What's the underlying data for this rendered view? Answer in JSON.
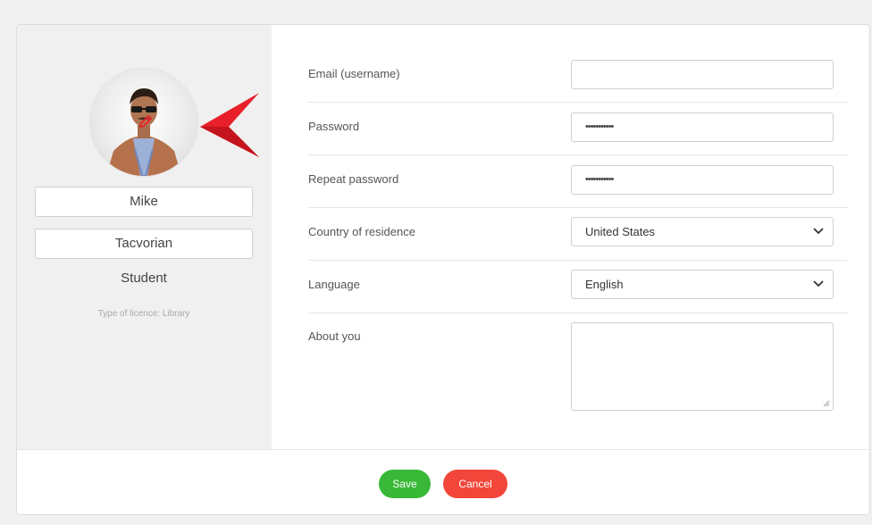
{
  "profile": {
    "first_name": "Mike",
    "last_name": "Tacvorian",
    "role": "Student",
    "licence": "Type of licence: Library",
    "avatar_icon": "user-photo",
    "edit_icon": "pencil-icon"
  },
  "form": {
    "email": {
      "label": "Email (username)",
      "value": ""
    },
    "password": {
      "label": "Password",
      "value": "•••••••••••"
    },
    "repeat_password": {
      "label": "Repeat password",
      "value": "•••••••••••"
    },
    "country": {
      "label": "Country of residence",
      "selected": "United States"
    },
    "language": {
      "label": "Language",
      "selected": "English"
    },
    "about": {
      "label": "About you",
      "value": ""
    }
  },
  "footer": {
    "save_label": "Save",
    "cancel_label": "Cancel"
  },
  "colors": {
    "left_panel_bg": "#f0f0f0",
    "save_button": "#38b836",
    "cancel_button": "#f2463b",
    "annotation_arrow": "#e8202a"
  }
}
